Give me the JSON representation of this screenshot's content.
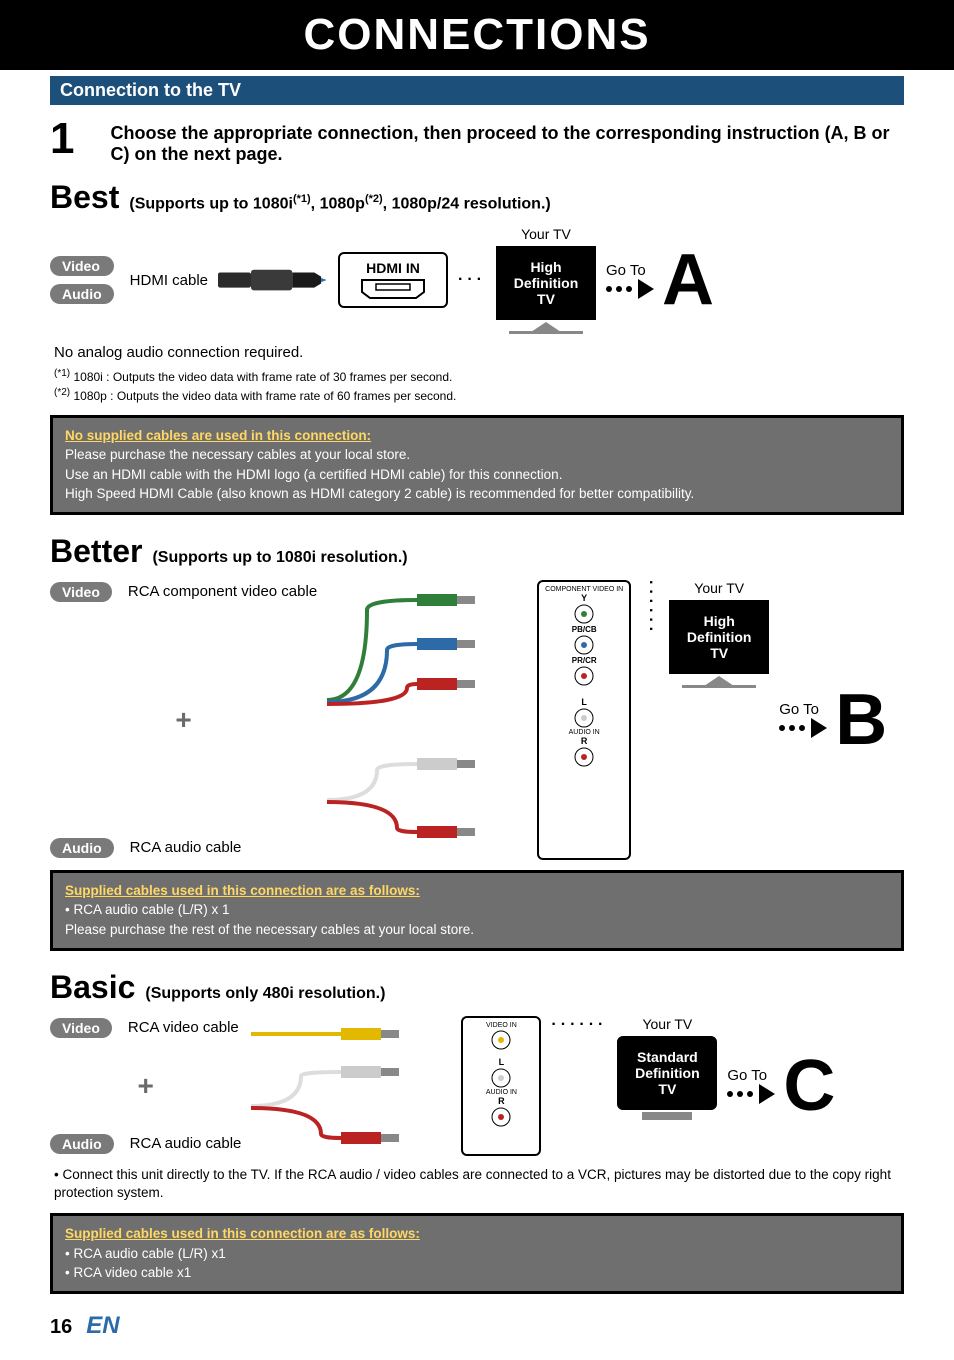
{
  "header": {
    "title": "CONNECTIONS",
    "subhead": "Connection to the TV"
  },
  "step": {
    "number": "1",
    "text": "Choose the appropriate connection, then proceed to the corresponding instruction (A, B or C) on the next page."
  },
  "best": {
    "label": "Best",
    "desc_pre": "(Supports up to 1080i",
    "sup1": "(*1)",
    "desc_mid": ", 1080p",
    "sup2": "(*2)",
    "desc_post": ", 1080p/24 resolution.)",
    "video_pill": "Video",
    "audio_pill": "Audio",
    "cable": "HDMI cable",
    "port_title": "HDMI IN",
    "tv_label": "Your TV",
    "tv_line1": "High",
    "tv_line2": "Definition",
    "tv_line3": "TV",
    "goto": "Go To",
    "letter": "A",
    "note": "No analog audio connection required.",
    "fn1_mark": "(*1)",
    "fn1": "1080i  : Outputs the video data with frame rate of 30 frames per second.",
    "fn2_mark": "(*2)",
    "fn2": "1080p : Outputs the video data with frame rate of 60 frames per second.",
    "info_head": "No supplied cables are used in this connection:",
    "info_l1": "Please purchase the necessary cables at your local store.",
    "info_l2": "Use an HDMI cable with the HDMI logo (a certified HDMI cable) for this connection.",
    "info_l3": "High Speed HDMI Cable (also known as HDMI category 2 cable) is recommended for better compatibility."
  },
  "better": {
    "label": "Better",
    "desc": "(Supports up to 1080i resolution.)",
    "video_pill": "Video",
    "audio_pill": "Audio",
    "cable_v": "RCA component video cable",
    "cable_a": "RCA audio cable",
    "port_top": "COMPONENT VIDEO IN",
    "port_y": "Y",
    "port_pb": "PB/CB",
    "port_pr": "PR/CR",
    "port_l": "L",
    "port_audioin": "AUDIO IN",
    "port_r": "R",
    "tv_label": "Your TV",
    "tv_line1": "High",
    "tv_line2": "Definition",
    "tv_line3": "TV",
    "goto": "Go To",
    "letter": "B",
    "info_head": "Supplied cables used in this connection are as follows:",
    "info_l1": "• RCA audio cable (L/R) x 1",
    "info_l2": "Please purchase the rest of the necessary cables at your local store."
  },
  "basic": {
    "label": "Basic",
    "desc": "(Supports only 480i resolution.)",
    "video_pill": "Video",
    "audio_pill": "Audio",
    "cable_v": "RCA video cable",
    "cable_a": "RCA audio cable",
    "port_videoin": "VIDEO IN",
    "port_l": "L",
    "port_audioin": "AUDIO IN",
    "port_r": "R",
    "tv_label": "Your TV",
    "tv_line1": "Standard",
    "tv_line2": "Definition",
    "tv_line3": "TV",
    "goto": "Go To",
    "letter": "C",
    "bullet": "• Connect this unit directly to the TV. If the RCA audio / video cables are connected to a VCR, pictures may be distorted due to the copy right protection system.",
    "info_head": "Supplied cables used in this connection are as follows:",
    "info_l1": "• RCA audio cable (L/R) x1",
    "info_l2": "• RCA video cable x1"
  },
  "footer": {
    "page": "16",
    "lang": "EN"
  }
}
